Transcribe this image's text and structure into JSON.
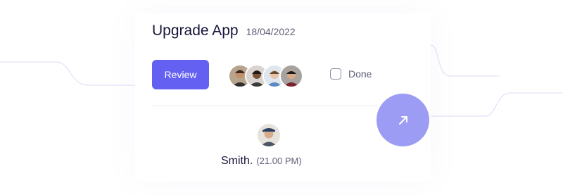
{
  "card": {
    "title": "Upgrade App",
    "date": "18/04/2022",
    "review_label": "Review",
    "done_label": "Done",
    "done_checked": false,
    "assignees": [
      {
        "name": "assignee-1"
      },
      {
        "name": "assignee-2"
      },
      {
        "name": "assignee-3"
      },
      {
        "name": "assignee-4"
      }
    ]
  },
  "fab": {
    "icon": "arrow-up-right-icon"
  },
  "user": {
    "name": "Smith.",
    "time": "(21.00 PM)"
  },
  "colors": {
    "accent": "#6461f2",
    "fab": "#9c9cf5",
    "title": "#16163a",
    "muted": "#5e6077",
    "lines": "#d9d9f5"
  }
}
